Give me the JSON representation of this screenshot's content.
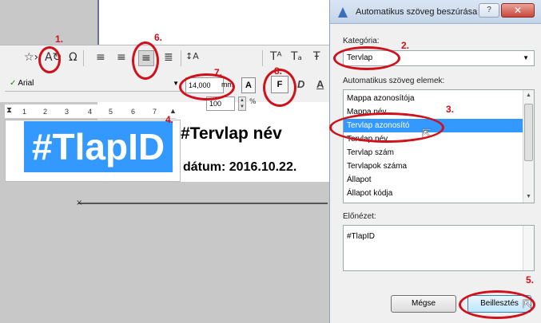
{
  "toolbar": {
    "icons": [
      "star-icon",
      "autotext-icon",
      "omega-icon",
      "align-left-icon",
      "align-center-icon",
      "align-right-icon",
      "justify-icon",
      "line-spacing-icon",
      "superscript-icon",
      "subscript-icon",
      "strikethrough-icon"
    ],
    "line_spacing_value": "100",
    "percent": "%",
    "font_name": "Arial",
    "font_size": "14,000",
    "font_unit": "mm",
    "bold_label": "F",
    "italic_label": "D",
    "underline_label": "A"
  },
  "ruler": {
    "ticks": [
      "1",
      "2",
      "3",
      "4",
      "5",
      "6",
      "7"
    ]
  },
  "document": {
    "selected_text": "#TlapID",
    "title_text": "#Tervlap név",
    "date_text": "dátum: 2016.10.22."
  },
  "annotations": {
    "n1": "1.",
    "n2": "2.",
    "n3": "3.",
    "n4": "4.",
    "n5": "5.",
    "n6": "6.",
    "n7": "7.",
    "n8": "8."
  },
  "dialog": {
    "title": "Automatikus szöveg beszúrása",
    "help_label": "?",
    "close_label": "✕",
    "category_label": "Kategória:",
    "category_value": "Tervlap",
    "elements_label": "Automatikus szöveg elemek:",
    "items": [
      "Mappa azonosítója",
      "Mappa név",
      "Tervlap azonosító",
      "Tervlap név",
      "Tervlap szám",
      "Tervlapok száma",
      "Állapot",
      "Állapot kódja"
    ],
    "selected_index": 2,
    "preview_label": "Előnézet:",
    "preview_value": "#TlapID",
    "cancel_label": "Mégse",
    "insert_label": "Beillesztés"
  },
  "colors": {
    "selection": "#3399ff",
    "annotation": "#d0101a"
  }
}
